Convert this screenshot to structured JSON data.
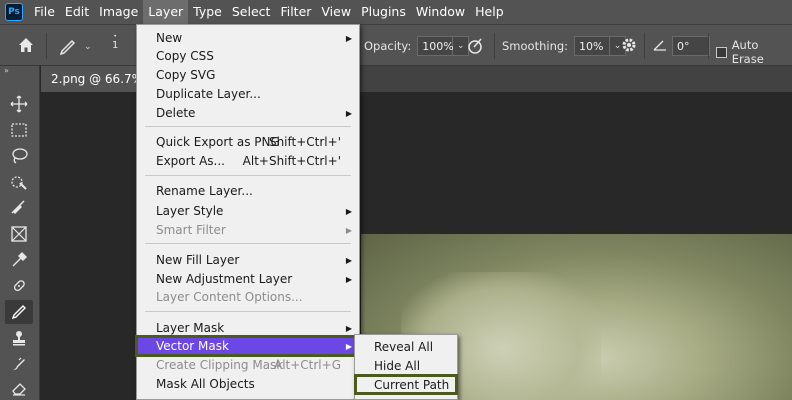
{
  "app": {
    "logo_text": "Ps",
    "menus": [
      "File",
      "Edit",
      "Image",
      "Layer",
      "Type",
      "Select",
      "Filter",
      "View",
      "Plugins",
      "Window",
      "Help"
    ],
    "active_menu": "Layer"
  },
  "options_bar": {
    "brush_size": "1",
    "opacity_label": "Opacity:",
    "opacity_value": "100%",
    "smoothing_label": "Smoothing:",
    "smoothing_value": "10%",
    "angle_value": "0°",
    "auto_erase_label": "Auto Erase",
    "auto_erase_checked": false
  },
  "tools": {
    "collapse_glyph": "»",
    "items": [
      "move-tool",
      "marquee-tool",
      "lasso-tool",
      "quick-selection-tool",
      "crop-tool",
      "frame-tool",
      "eyedropper-tool",
      "spot-healing-tool",
      "pencil-tool",
      "clone-stamp-tool",
      "history-brush-tool",
      "eraser-tool"
    ],
    "selected": "pencil-tool"
  },
  "document": {
    "tab_title": "2.png @ 66.7% ("
  },
  "layer_menu": {
    "items": [
      {
        "label": "New",
        "shortcut": "",
        "submenu": true,
        "disabled": false
      },
      {
        "label": "Copy CSS",
        "shortcut": "",
        "submenu": false,
        "disabled": false
      },
      {
        "label": "Copy SVG",
        "shortcut": "",
        "submenu": false,
        "disabled": false
      },
      {
        "label": "Duplicate Layer...",
        "shortcut": "",
        "submenu": false,
        "disabled": false
      },
      {
        "label": "Delete",
        "shortcut": "",
        "submenu": true,
        "disabled": false
      },
      {
        "label": "Quick Export as PNG",
        "shortcut": "Shift+Ctrl+'",
        "submenu": false,
        "disabled": false
      },
      {
        "label": "Export As...",
        "shortcut": "Alt+Shift+Ctrl+'",
        "submenu": false,
        "disabled": false
      },
      {
        "label": "Rename Layer...",
        "shortcut": "",
        "submenu": false,
        "disabled": false
      },
      {
        "label": "Layer Style",
        "shortcut": "",
        "submenu": true,
        "disabled": false
      },
      {
        "label": "Smart Filter",
        "shortcut": "",
        "submenu": true,
        "disabled": true
      },
      {
        "label": "New Fill Layer",
        "shortcut": "",
        "submenu": true,
        "disabled": false
      },
      {
        "label": "New Adjustment Layer",
        "shortcut": "",
        "submenu": true,
        "disabled": false
      },
      {
        "label": "Layer Content Options...",
        "shortcut": "",
        "submenu": false,
        "disabled": true
      },
      {
        "label": "Layer Mask",
        "shortcut": "",
        "submenu": true,
        "disabled": false
      },
      {
        "label": "Vector Mask",
        "shortcut": "",
        "submenu": true,
        "disabled": false,
        "highlighted": true
      },
      {
        "label": "Create Clipping Mask",
        "shortcut": "Alt+Ctrl+G",
        "submenu": false,
        "disabled": true
      },
      {
        "label": "Mask All Objects",
        "shortcut": "",
        "submenu": false,
        "disabled": false
      }
    ]
  },
  "vector_mask_submenu": {
    "items": [
      {
        "label": "Reveal All"
      },
      {
        "label": "Hide All"
      },
      {
        "label": "Current Path",
        "highlighted": true
      }
    ]
  },
  "colors": {
    "highlight": "#6b48e6",
    "focus_outline": "#4d5a1e",
    "menu_bg": "#f0f0f0",
    "chrome": "#535353"
  }
}
